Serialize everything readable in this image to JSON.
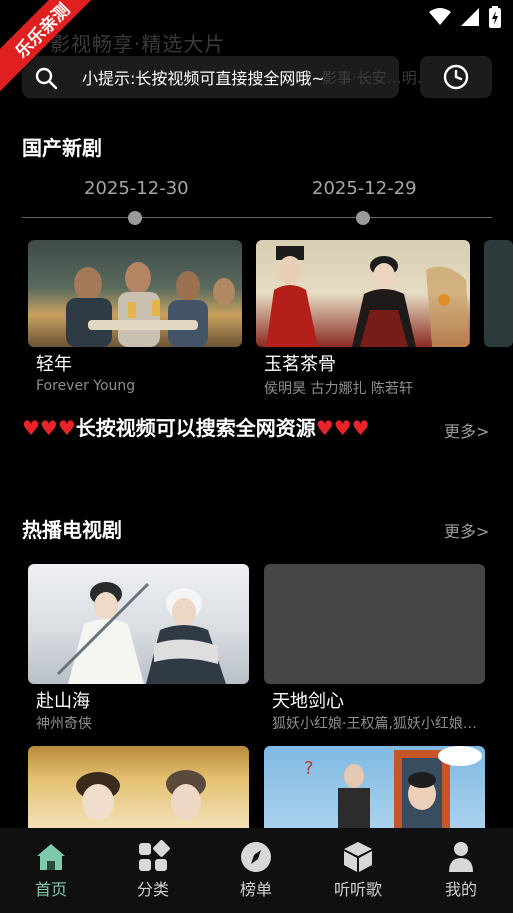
{
  "app": {
    "ribbon": "乐乐亲测",
    "ghost_title": "影视畅享·精选大片",
    "search_hint": "小提示:长按视频可直接搜全网哦~",
    "search_ghost": "影事·长安…明…"
  },
  "new_series": {
    "title": "国产新剧",
    "dates": [
      "2025-12-30",
      "2025-12-29"
    ],
    "items": [
      {
        "title": "轻年",
        "subtitle": "Forever Young"
      },
      {
        "title": "玉茗茶骨",
        "subtitle": "侯明昊 古力娜扎 陈若轩"
      }
    ]
  },
  "notice": {
    "hearts_left": "♥♥♥",
    "text": "长按视频可以搜索全网资源",
    "hearts_right": "♥♥♥",
    "more": "更多>"
  },
  "hot_tv": {
    "title": "热播电视剧",
    "more": "更多>",
    "items": [
      {
        "title": "赴山海",
        "subtitle": "神州奇侠"
      },
      {
        "title": "天地剑心",
        "subtitle": "狐妖小红娘·王权篇,狐妖小红娘·王权篇"
      },
      {
        "title": "",
        "subtitle": ""
      },
      {
        "title": "",
        "subtitle": ""
      }
    ]
  },
  "nav": [
    {
      "label": "首页",
      "icon": "home-icon",
      "active": true
    },
    {
      "label": "分类",
      "icon": "grid-icon",
      "active": false
    },
    {
      "label": "榜单",
      "icon": "compass-icon",
      "active": false
    },
    {
      "label": "听听歌",
      "icon": "cube-icon",
      "active": false
    },
    {
      "label": "我的",
      "icon": "person-icon",
      "active": false
    }
  ],
  "colors": {
    "accent": "#7fc8a9",
    "heart": "#e8232a",
    "ribbon": "#e02020"
  }
}
